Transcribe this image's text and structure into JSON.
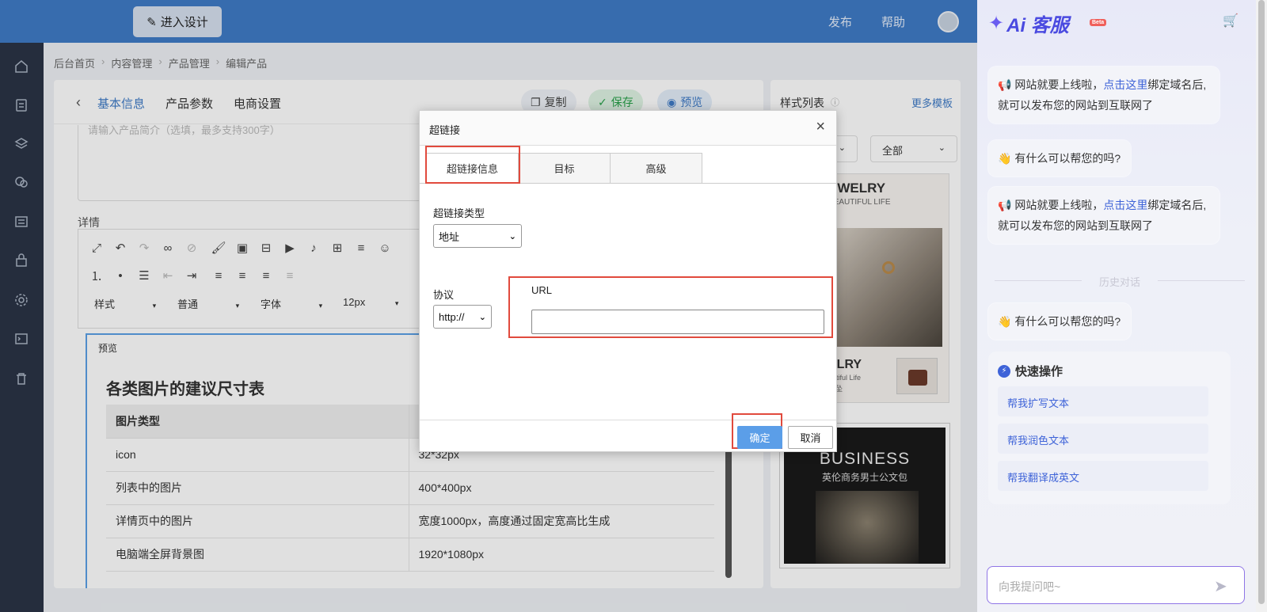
{
  "topbar": {
    "design_button": "进入设计",
    "publish": "发布",
    "help": "帮助"
  },
  "breadcrumb": [
    "后台首页",
    "内容管理",
    "产品管理",
    "编辑产品"
  ],
  "editor": {
    "tabs": [
      "基本信息",
      "产品参数",
      "电商设置"
    ],
    "actions": {
      "copy": "复制",
      "save": "保存",
      "preview": "预览"
    },
    "summary_placeholder": "请输入产品简介（选填，最多支持300字）",
    "detail_label": "详情",
    "toolbar_selects": {
      "style": "样式",
      "format": "普通",
      "font": "字体",
      "size": "12px"
    },
    "preview_label": "预览",
    "doc_title": "各类图片的建议尺寸表",
    "table": {
      "headers": [
        "图片类型",
        ""
      ],
      "rows": [
        [
          "icon",
          "32*32px"
        ],
        [
          "列表中的图片",
          "400*400px"
        ],
        [
          "详情页中的图片",
          "宽度1000px，高度通过固定宽高比生成"
        ],
        [
          "电脑端全屏背景图",
          "1920*1080px"
        ]
      ]
    }
  },
  "style_list": {
    "title": "样式列表",
    "more": "更多模板",
    "filter_all": "全部",
    "thumb1_lines": [
      "EWELRY",
      "BEAUTIFUL LIFE",
      "坠",
      "ELRY",
      "autiful Life",
      "耳坠"
    ],
    "thumb2_lines": [
      "BUSINESS",
      "英伦商务男士公文包"
    ]
  },
  "dialog": {
    "title": "超链接",
    "close": "×",
    "tabs": [
      "超链接信息",
      "目标",
      "高级"
    ],
    "link_type_label": "超链接类型",
    "link_type_value": "地址",
    "protocol_label": "协议",
    "protocol_value": "http://",
    "url_label": "URL",
    "url_value": "",
    "ok": "确定",
    "cancel": "取消"
  },
  "ai": {
    "logo_text": "Ai 客服",
    "beta": "Beta",
    "msg1_pre": "网站就要上线啦，",
    "msg1_link": "点击这里",
    "msg1_post": "绑定域名后,就可以发布您的网站到互联网了",
    "msg2": "有什么可以帮您的吗?",
    "history": "历史对话",
    "quick_title": "快速操作",
    "quick_items": [
      "帮我扩写文本",
      "帮我润色文本",
      "帮我翻译成英文"
    ],
    "ask_placeholder": "向我提问吧~"
  },
  "colors": {
    "topbar": "#3f7bc7",
    "sidebar": "#2b3446",
    "highlight": "#e14a3d",
    "ok_button": "#5b9ee8",
    "ai_accent": "#4a4ae0"
  }
}
